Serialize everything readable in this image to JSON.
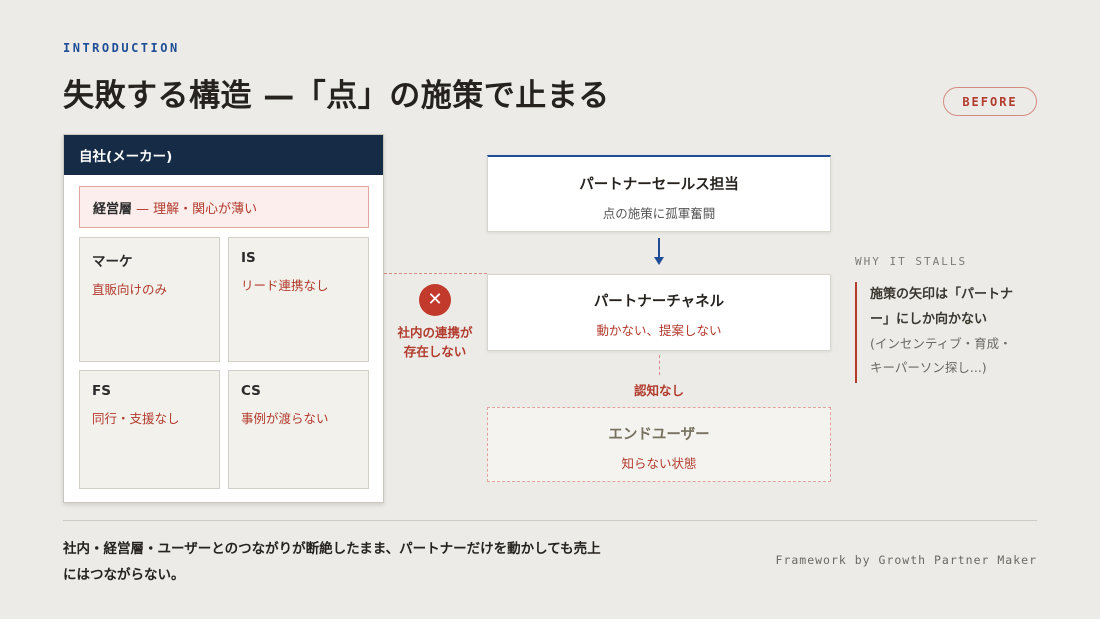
{
  "eyebrow": "INTRODUCTION",
  "title": "失敗する構造 —「点」の施策で止まる",
  "badge": "BEFORE",
  "company": {
    "header": "自社(メーカー)",
    "management": {
      "label": "経営層",
      "note": "— 理解・関心が薄い"
    },
    "departments": [
      {
        "name": "マーケ",
        "note": "直販向けのみ"
      },
      {
        "name": "IS",
        "note": "リード連携なし"
      },
      {
        "name": "FS",
        "note": "同行・支援なし"
      },
      {
        "name": "CS",
        "note": "事例が渡らない"
      }
    ]
  },
  "disconnect": {
    "icon": "✕",
    "label_line1": "社内の連携が",
    "label_line2": "存在しない"
  },
  "flow": {
    "partner_sales": {
      "title": "パートナーセールス担当",
      "sub": "点の施策に孤軍奮闘"
    },
    "partner_channel": {
      "title": "パートナーチャネル",
      "sub": "動かない、提案しない"
    },
    "unaware_label": "認知なし",
    "end_user": {
      "title": "エンドユーザー",
      "sub": "知らない状態"
    }
  },
  "why": {
    "title": "WHY IT STALLS",
    "main_line1": "施策の矢印は「パートナ",
    "main_line2": "ー」にしか向かない",
    "sub_line1": "(インセンティブ・育成・",
    "sub_line2": "キーパーソン探し...)"
  },
  "footer": {
    "line1": "社内・経営層・ユーザーとのつながりが断絶したまま、パートナーだけを動かしても売上",
    "line2": "にはつながらない。",
    "credit": "Framework by Growth Partner Maker"
  },
  "colors": {
    "navy": "#152b46",
    "blue": "#1f4e96",
    "red": "#b23b2e",
    "background": "#ecebe7"
  }
}
